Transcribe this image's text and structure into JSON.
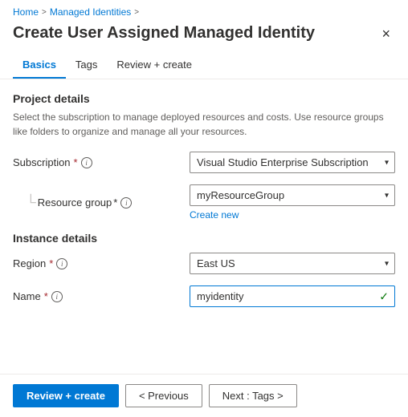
{
  "breadcrumb": {
    "home": "Home",
    "managed_identities": "Managed Identities",
    "sep1": ">",
    "sep2": ">"
  },
  "page": {
    "title": "Create User Assigned Managed Identity",
    "close_label": "×"
  },
  "tabs": [
    {
      "id": "basics",
      "label": "Basics",
      "active": true
    },
    {
      "id": "tags",
      "label": "Tags",
      "active": false
    },
    {
      "id": "review_create",
      "label": "Review + create",
      "active": false
    }
  ],
  "project_details": {
    "title": "Project details",
    "desc": "Select the subscription to manage deployed resources and costs. Use resource groups like folders to organize and manage all your resources."
  },
  "form": {
    "subscription_label": "Subscription",
    "subscription_value": "Visual Studio Enterprise Subscription",
    "resource_group_label": "Resource group",
    "resource_group_value": "myResourceGroup",
    "create_new_link": "Create new",
    "instance_title": "Instance details",
    "region_label": "Region",
    "region_value": "East US",
    "name_label": "Name",
    "name_value": "myidentity"
  },
  "footer": {
    "review_create_label": "Review + create",
    "previous_label": "< Previous",
    "next_label": "Next : Tags >"
  },
  "icons": {
    "info": "i",
    "chevron_down": "▾",
    "check": "✓"
  }
}
